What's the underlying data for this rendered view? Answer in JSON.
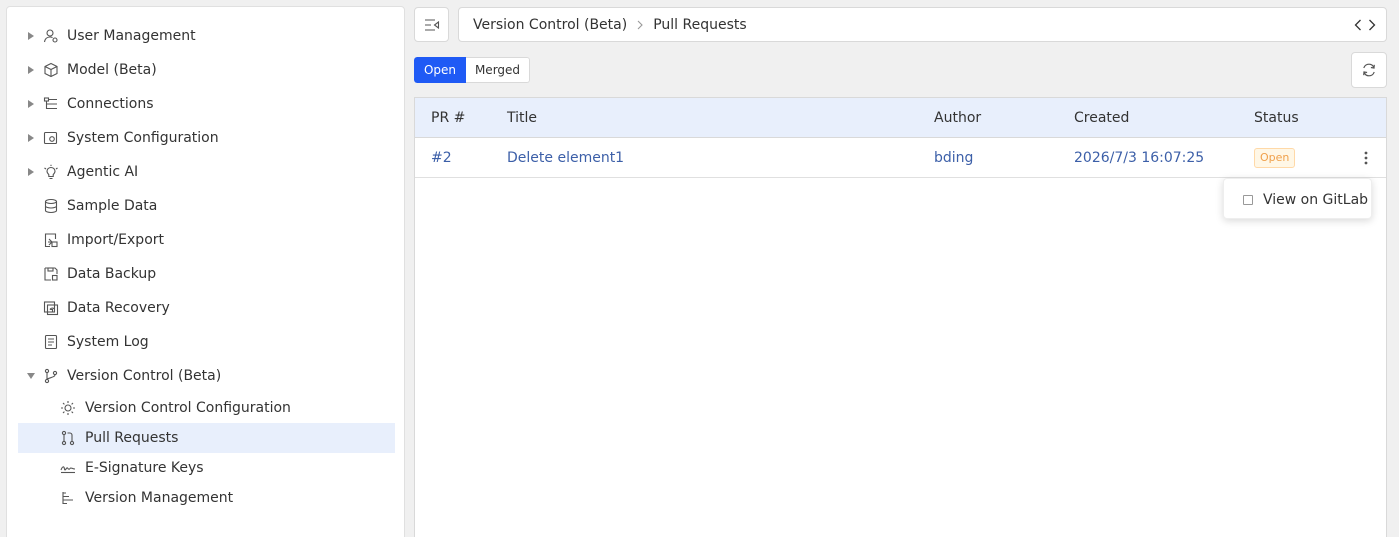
{
  "sidebar": {
    "items": [
      {
        "label": "User Management",
        "icon": "user-gear-icon",
        "expandable": true
      },
      {
        "label": "Model (Beta)",
        "icon": "cube-icon",
        "expandable": true
      },
      {
        "label": "Connections",
        "icon": "connections-icon",
        "expandable": true
      },
      {
        "label": "System Configuration",
        "icon": "system-config-icon",
        "expandable": true
      },
      {
        "label": "Agentic AI",
        "icon": "ai-bulb-icon",
        "expandable": true
      },
      {
        "label": "Sample Data",
        "icon": "database-icon",
        "expandable": false
      },
      {
        "label": "Import/Export",
        "icon": "import-export-icon",
        "expandable": false
      },
      {
        "label": "Data Backup",
        "icon": "backup-icon",
        "expandable": false
      },
      {
        "label": "Data Recovery",
        "icon": "recovery-icon",
        "expandable": false
      },
      {
        "label": "System Log",
        "icon": "log-icon",
        "expandable": false
      },
      {
        "label": "Version Control (Beta)",
        "icon": "branch-icon",
        "expandable": true,
        "expanded": true
      }
    ],
    "sub_items": [
      {
        "label": "Version Control Configuration",
        "icon": "gear-icon"
      },
      {
        "label": "Pull Requests",
        "icon": "pull-request-icon",
        "selected": true
      },
      {
        "label": "E-Signature Keys",
        "icon": "signature-icon"
      },
      {
        "label": "Version Management",
        "icon": "version-tree-icon"
      }
    ]
  },
  "breadcrumb": {
    "parent": "Version Control (Beta)",
    "current": "Pull Requests"
  },
  "filter": {
    "open_label": "Open",
    "merged_label": "Merged",
    "active": "Open"
  },
  "table": {
    "headers": {
      "pr": "PR #",
      "title": "Title",
      "author": "Author",
      "created": "Created",
      "status": "Status"
    },
    "rows": [
      {
        "pr": "#2",
        "title": "Delete element1",
        "author": "bding",
        "created": "2026/7/3 16:07:25",
        "status": "Open"
      }
    ]
  },
  "row_menu": {
    "items": [
      {
        "label": "View on GitLab"
      }
    ]
  },
  "colors": {
    "accent": "#1f5af5",
    "header_bg": "#e8effc",
    "link": "#3c5fa8",
    "status_open": "#f0a04b"
  }
}
